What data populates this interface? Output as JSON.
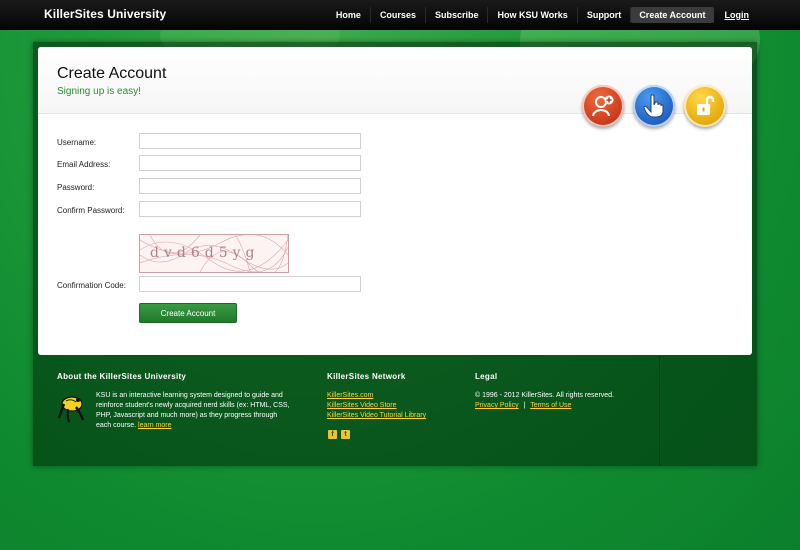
{
  "topbar": {
    "brand": "KillerSites University",
    "nav": [
      "Home",
      "Courses",
      "Subscribe",
      "How KSU Works",
      "Support",
      "Create Account",
      "Login"
    ]
  },
  "page": {
    "title": "Create Account",
    "subtitle": "Signing up is easy!"
  },
  "badges": [
    "add-user-icon",
    "hand-pointer-icon",
    "unlock-icon"
  ],
  "form": {
    "username_label": "Username:",
    "email_label": "Email Address:",
    "password_label": "Password:",
    "confirm_label": "Confirm Password:",
    "code_label": "Confirmation Code:",
    "captcha_text": "dvd6d5yg",
    "submit": "Create Account"
  },
  "footer": {
    "about_title": "About the KillerSites University",
    "about_text": "KSU is an interactive learning system designed to guide and reinforce student's newly acquired nerd skills (ex: HTML, CSS, PHP, Javascript and much more) as they progress through each course.",
    "about_link": "learn more",
    "network_title": "KillerSites Network",
    "network_links": [
      "KillerSites.com",
      "KillerSites Video Store",
      "KillerSites Video Tutorial Library"
    ],
    "social": [
      "f",
      "t"
    ],
    "legal_title": "Legal",
    "copyright": "© 1996 - 2012 KillerSites. All rights reserved.",
    "privacy": "Privacy Policy",
    "separator": "|",
    "terms": "Terms of Use"
  },
  "colors": {
    "accent_green": "#2d8a34",
    "link_yellow": "#ffd23a"
  }
}
